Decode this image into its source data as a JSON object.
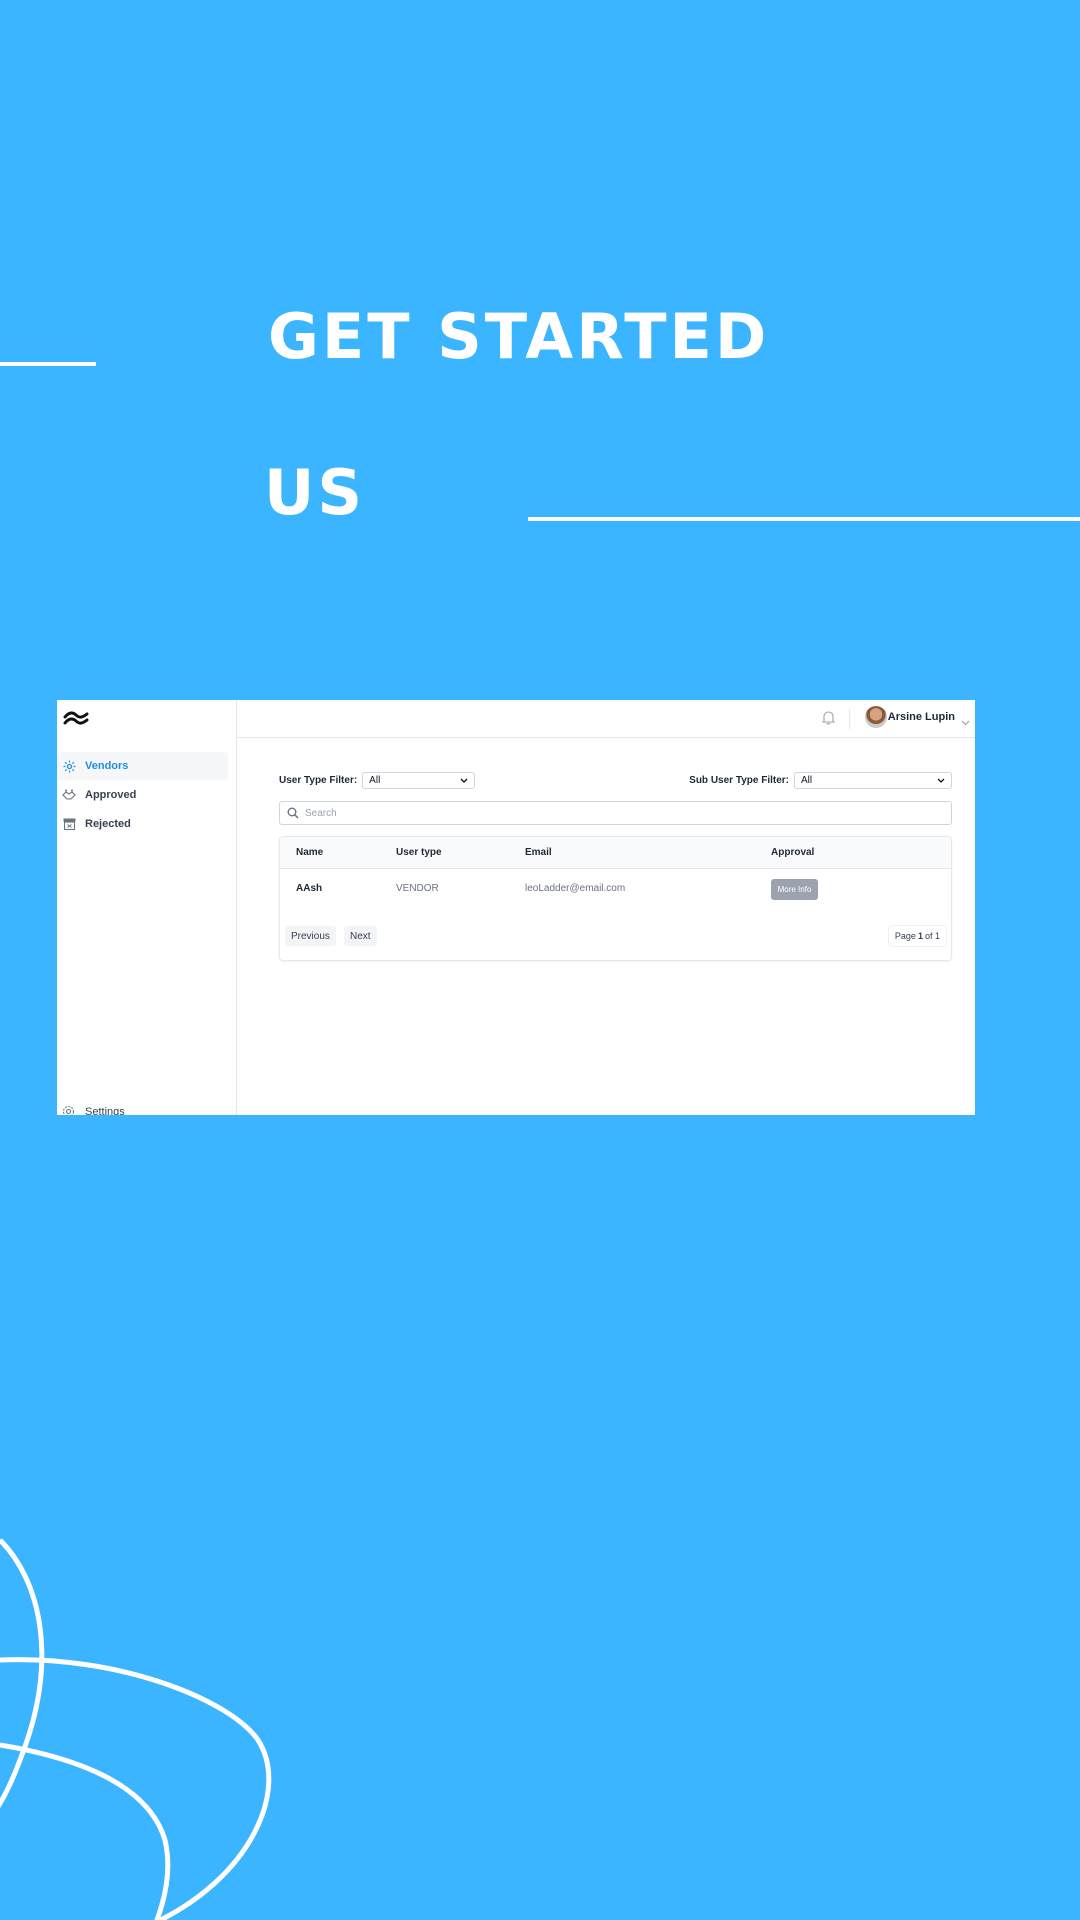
{
  "hero": {
    "line1": "GET STARTED",
    "line2": "US"
  },
  "colors": {
    "background": "#3bb5ff",
    "accent": "#1d8fdc"
  },
  "app": {
    "sidebar": {
      "items": [
        {
          "label": "Vendors",
          "icon": "vendors-icon",
          "active": true
        },
        {
          "label": "Approved",
          "icon": "approved-icon",
          "active": false
        },
        {
          "label": "Rejected",
          "icon": "rejected-icon",
          "active": false
        }
      ],
      "settings_label": "Settings"
    },
    "header": {
      "user_name": "Arsine Lupin"
    },
    "filters": {
      "user_type_label": "User Type Filter:",
      "user_type_value": "All",
      "sub_user_type_label": "Sub User Type Filter:",
      "sub_user_type_value": "All"
    },
    "search": {
      "placeholder": "Search"
    },
    "table": {
      "columns": [
        "Name",
        "User type",
        "Email",
        "Approval"
      ],
      "rows": [
        {
          "name": "AAsh",
          "user_type": "VENDOR",
          "email": "leoLadder@email.com",
          "action": "More Info"
        }
      ]
    },
    "pagination": {
      "previous": "Previous",
      "next": "Next",
      "page_prefix": "Page",
      "current": "1",
      "of": "of",
      "total": "1"
    }
  }
}
